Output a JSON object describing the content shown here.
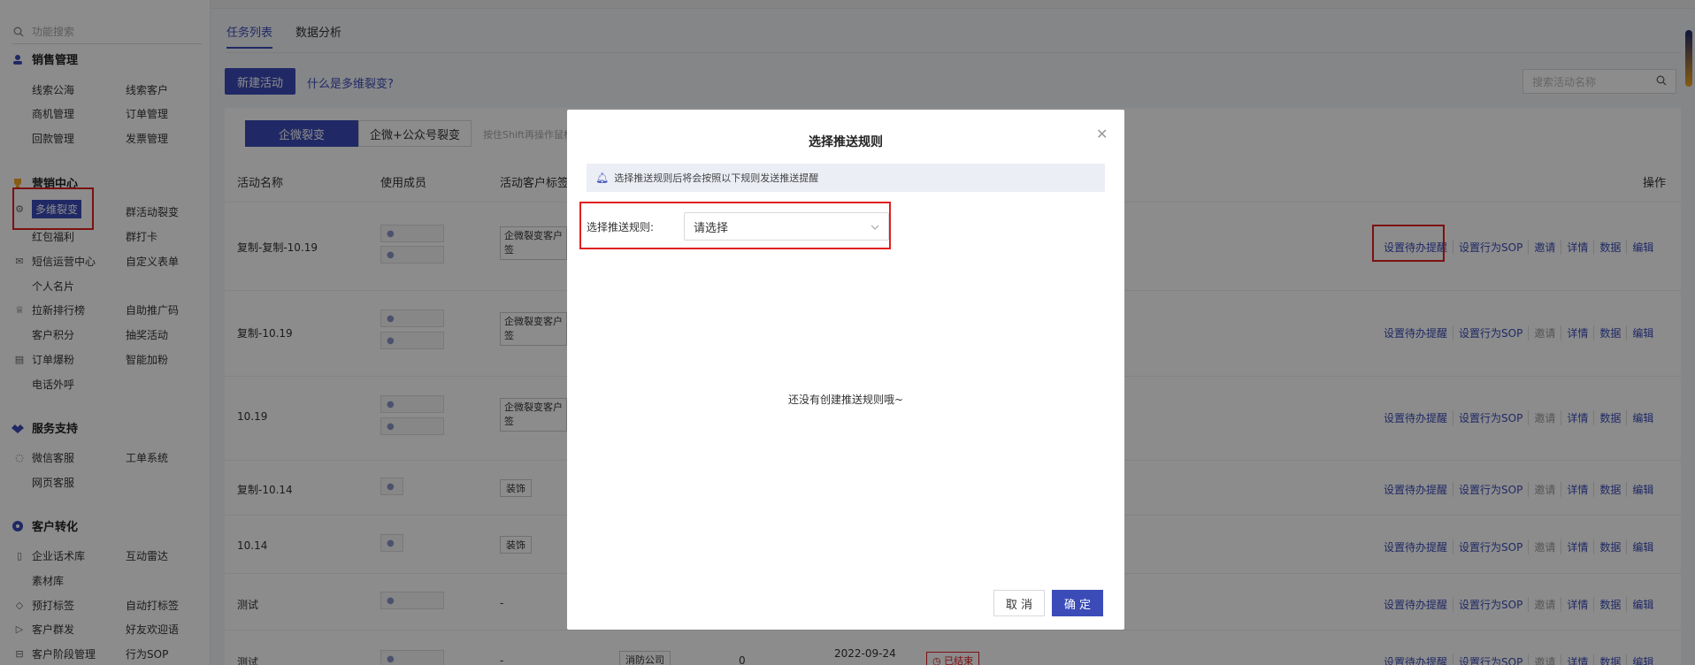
{
  "sidebar": {
    "search_placeholder": "功能搜索",
    "groups": [
      {
        "title": "销售管理",
        "items": [
          "线索公海",
          "线索客户",
          "商机管理",
          "订单管理",
          "回款管理",
          "发票管理"
        ]
      },
      {
        "title": "营销中心",
        "items": [
          "多维裂变",
          "群活动裂变",
          "红包福利",
          "群打卡",
          "短信运营中心",
          "自定义表单",
          "个人名片",
          "拉新排行榜",
          "自助推广码",
          "客户积分",
          "抽奖活动",
          "订单爆粉",
          "智能加粉",
          "电话外呼"
        ]
      },
      {
        "title": "服务支持",
        "items": [
          "微信客服",
          "工单系统",
          "网页客服"
        ]
      },
      {
        "title": "客户转化",
        "items": [
          "企业话术库",
          "互动雷达",
          "素材库",
          "预打标签",
          "自动打标签",
          "客户群发",
          "好友欢迎语",
          "客户阶段管理",
          "行为SOP"
        ]
      }
    ]
  },
  "main": {
    "tabs": [
      "任务列表",
      "数据分析"
    ],
    "new_button": "新建活动",
    "help_link": "什么是多维裂变?",
    "search_placeholder": "搜索活动名称",
    "segments": [
      "企微裂变",
      "企微+公众号裂变"
    ],
    "segment_hint": "按住Shift再操作鼠标",
    "columns": [
      "活动名称",
      "使用成员",
      "活动客户标签",
      "操作"
    ],
    "rows": [
      {
        "name": "复制-复制-10.19",
        "tag": "企微裂变客户 签"
      },
      {
        "name": "复制-10.19",
        "tag": "企微裂变客户 签"
      },
      {
        "name": "10.19",
        "tag": "企微裂变客户 签"
      },
      {
        "name": "复制-10.14",
        "tag": "装饰"
      },
      {
        "name": "10.14",
        "tag": "装饰"
      },
      {
        "name": "测试",
        "tag": "-"
      },
      {
        "name": "测试",
        "tag": "-",
        "extra_tag": "消防公司",
        "count": "0",
        "date": "2022-09-24",
        "status": "已结束"
      }
    ],
    "ops": [
      "设置待办提醒",
      "设置行为SOP",
      "邀请",
      "详情",
      "数据",
      "编辑"
    ]
  },
  "modal": {
    "title": "选择推送规则",
    "notice": "选择推送规则后将会按照以下规则发送推送提醒",
    "label": "选择推送规则:",
    "select_placeholder": "请选择",
    "empty_text": "还没有创建推送规则哦~",
    "cancel": "取 消",
    "confirm": "确 定"
  }
}
